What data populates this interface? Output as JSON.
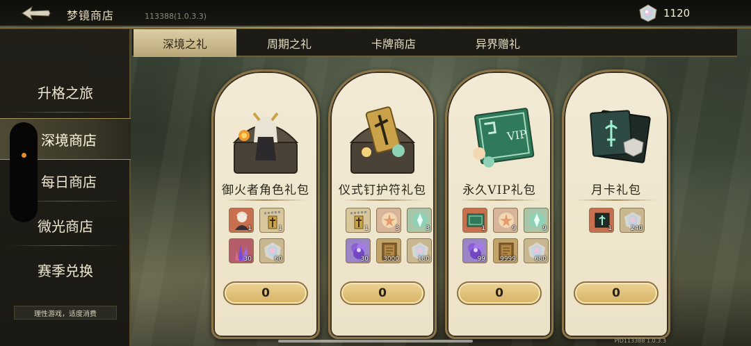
{
  "header": {
    "title": "梦镜商店",
    "version": "113388(1.0.3.3)",
    "currency_amount": "1120"
  },
  "sidebar": {
    "items": [
      {
        "label": "升格之旅"
      },
      {
        "label": "深境商店"
      },
      {
        "label": "每日商店"
      },
      {
        "label": "微光商店"
      },
      {
        "label": "赛季兑换"
      }
    ],
    "notice": "理性游戏，适度消费"
  },
  "tabs": [
    {
      "label": "深境之礼"
    },
    {
      "label": "周期之礼"
    },
    {
      "label": "卡牌商店"
    },
    {
      "label": "异界赠礼"
    }
  ],
  "cards": [
    {
      "name": "御火者角色礼包",
      "price": "0",
      "items": [
        {
          "icon": "character-portrait-icon",
          "qty": "1"
        },
        {
          "icon": "key-charm-icon",
          "qty": "1"
        },
        {
          "icon": "purple-crystal-icon",
          "qty": "30"
        },
        {
          "icon": "rainbow-gem-icon",
          "qty": "60"
        }
      ]
    },
    {
      "name": "仪式钉护符礼包",
      "price": "0",
      "items": [
        {
          "icon": "key-charm-icon",
          "qty": "1"
        },
        {
          "icon": "star-orb-icon",
          "qty": "3"
        },
        {
          "icon": "green-orb-icon",
          "qty": "3"
        },
        {
          "icon": "purple-flower-icon",
          "qty": "30"
        },
        {
          "icon": "book-icon",
          "qty": "3000"
        },
        {
          "icon": "rainbow-gem-icon",
          "qty": "180"
        }
      ]
    },
    {
      "name": "永久VIP礼包",
      "price": "0",
      "items": [
        {
          "icon": "vip-card-icon",
          "qty": "1"
        },
        {
          "icon": "star-orb-icon",
          "qty": "9"
        },
        {
          "icon": "green-orb-icon",
          "qty": "9"
        },
        {
          "icon": "purple-flower-icon",
          "qty": "99"
        },
        {
          "icon": "book-icon",
          "qty": "9999"
        },
        {
          "icon": "rainbow-gem-icon",
          "qty": "680"
        }
      ]
    },
    {
      "name": "月卡礼包",
      "price": "0",
      "items": [
        {
          "icon": "monthly-card-icon",
          "qty": "1"
        },
        {
          "icon": "rainbow-gem-icon",
          "qty": "240"
        }
      ]
    }
  ],
  "footer": {
    "pid": "PID113388  1.0.3.3"
  },
  "colors": {
    "accent_gold": "#d7b466",
    "card_bg": "#f2ead5",
    "tab_active": "#dccfa6",
    "notification_dot": "#f08b24"
  }
}
